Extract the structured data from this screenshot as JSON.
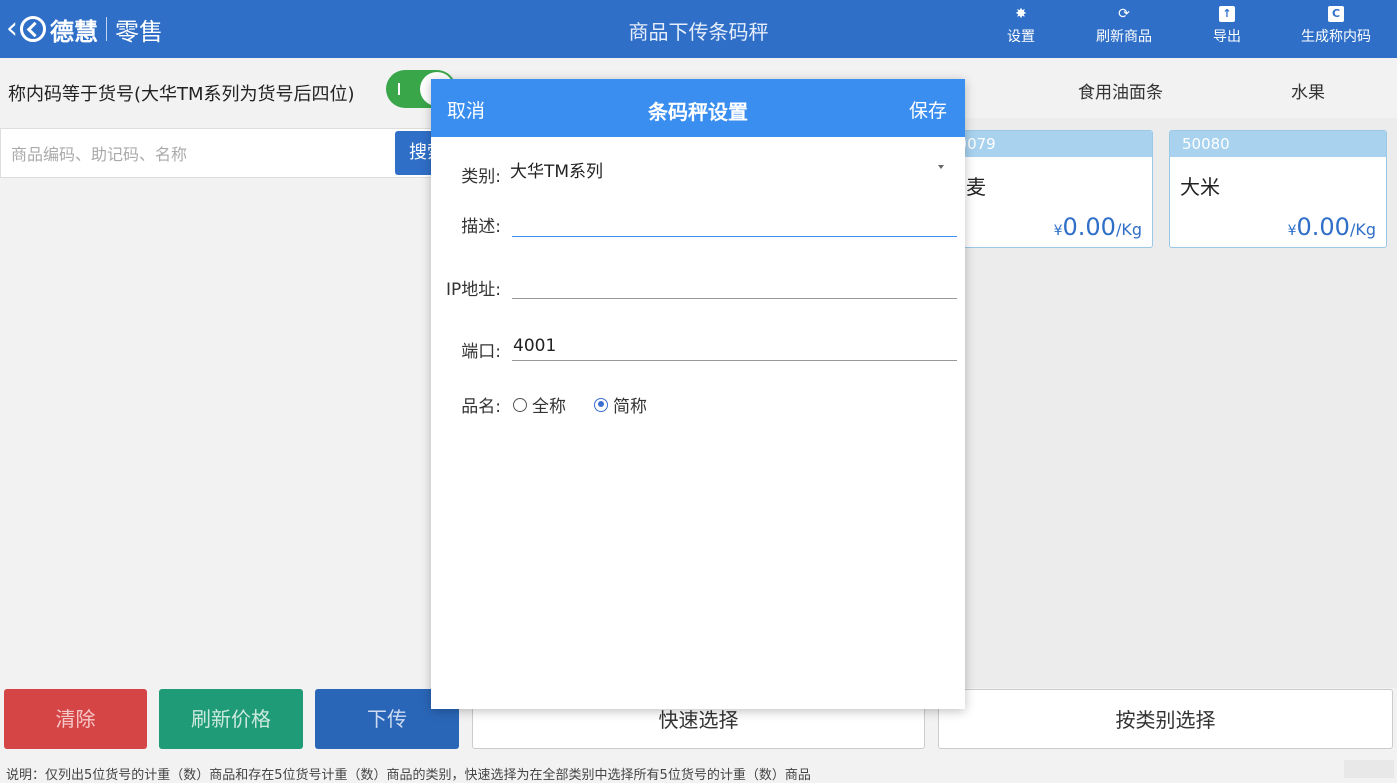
{
  "header": {
    "back_glyph": "‹",
    "brand_name": "德慧",
    "brand_sub": "零售",
    "title": "商品下传条码秤",
    "tools": [
      {
        "label": "设置",
        "icon": "gear-icon"
      },
      {
        "label": "刷新商品",
        "icon": "refresh-icon"
      },
      {
        "label": "导出",
        "icon": "export-icon"
      },
      {
        "label": "生成称内码",
        "icon": "c-icon"
      }
    ]
  },
  "left": {
    "toggle_label": "称内码等于货号(大华TM系列为货号后四位)",
    "toggle_on": true,
    "search_placeholder": "商品编码、助记码、名称",
    "search_button": "搜索"
  },
  "right": {
    "categories": [
      "食用油面条",
      "水果"
    ],
    "products": [
      {
        "code": "50079",
        "name": "荞麦",
        "yen": "¥",
        "price": "0.00",
        "unit": "/Kg"
      },
      {
        "code": "50080",
        "name": "大米",
        "yen": "¥",
        "price": "0.00",
        "unit": "/Kg"
      }
    ]
  },
  "bottom": {
    "clear": "清除",
    "refresh_price": "刷新价格",
    "upload": "下传",
    "quick_select": "快速选择",
    "by_category": "按类别选择",
    "note": "说明：仅列出5位货号的计重（数）商品和存在5位货号计重（数）商品的类别，快速选择为在全部类别中选择所有5位货号的计重（数）商品"
  },
  "dialog": {
    "cancel": "取消",
    "title": "条码秤设置",
    "save": "保存",
    "category_label": "类别:",
    "category_value": "大华TM系列",
    "desc_label": "描述:",
    "desc_value": "",
    "ip_label": "IP地址:",
    "ip_value": "",
    "port_label": "端口:",
    "port_value": "4001",
    "name_label": "品名:",
    "name_options": [
      "全称",
      "简称"
    ],
    "name_selected": "简称"
  },
  "colors": {
    "header_bg": "#2f6fc8",
    "dialog_header_bg": "#3a8ef0",
    "toggle_on": "#3aa64a",
    "clear_btn": "#d64545",
    "refresh_price_btn": "#1f9b77",
    "upload_btn": "#2a66b8"
  }
}
